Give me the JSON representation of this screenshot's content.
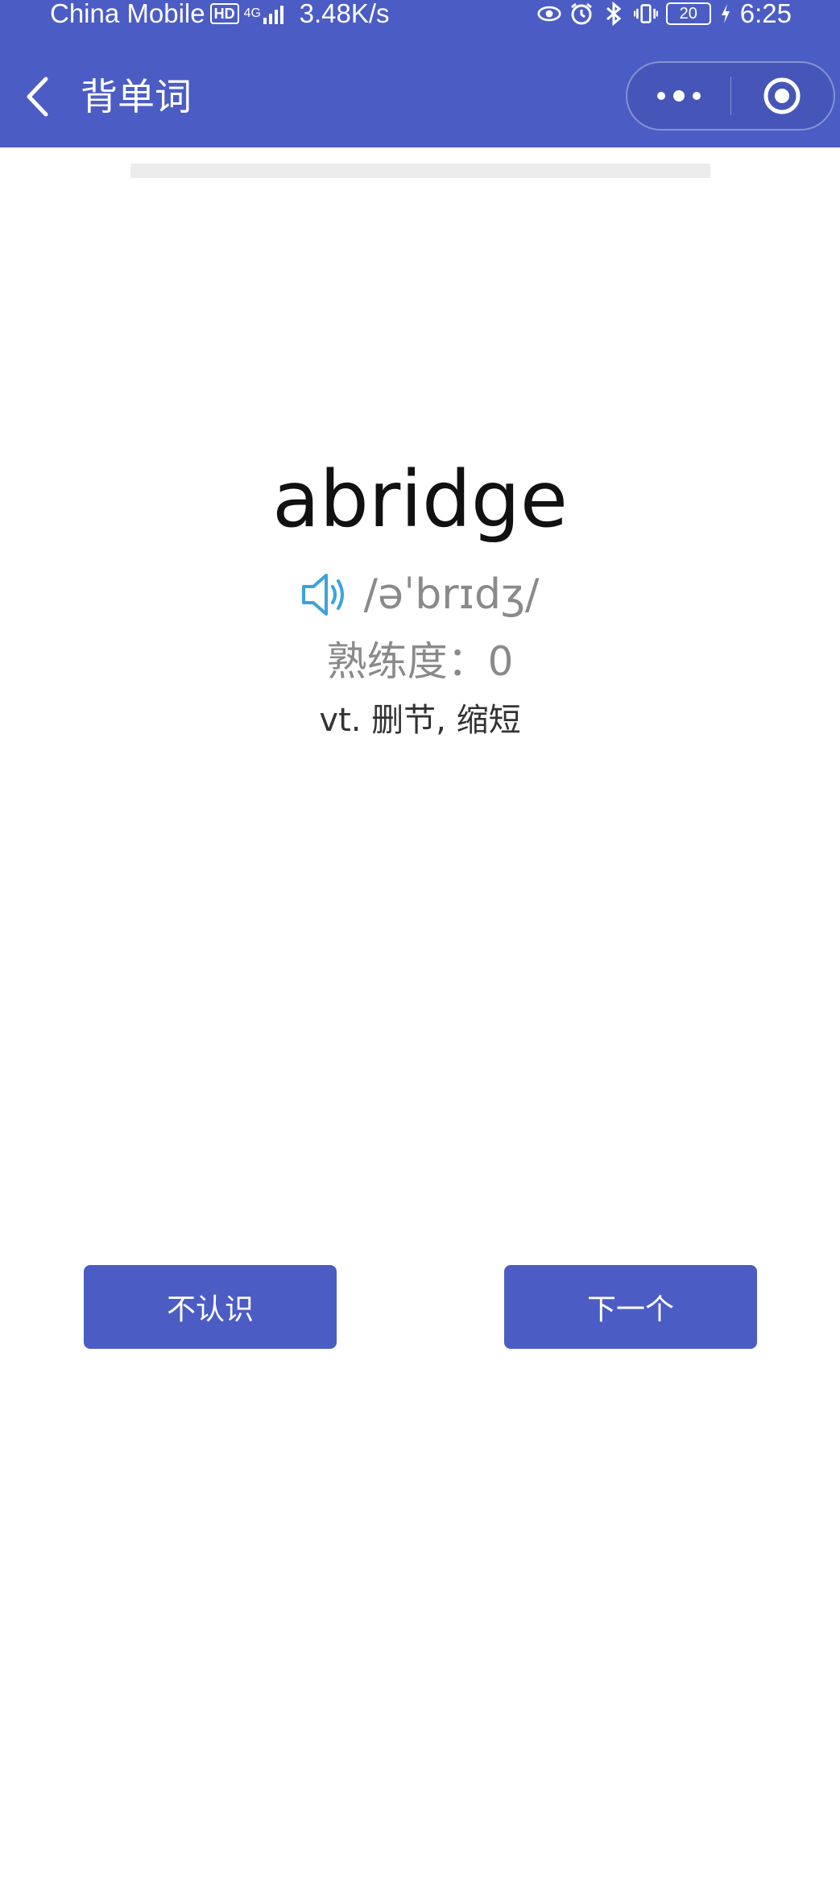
{
  "status_bar": {
    "carrier": "China Mobile",
    "hd": "HD",
    "network": "4G",
    "speed": "3.48K/s",
    "battery": "20",
    "time": "6:25",
    "icons": [
      "hd-icon",
      "signal-icon",
      "eye-icon",
      "alarm-icon",
      "bluetooth-icon",
      "vibrate-icon",
      "battery-icon",
      "charging-icon"
    ]
  },
  "nav": {
    "title": "背单词",
    "back_icon": "chevron-left-icon",
    "more_icon": "more-dots-icon",
    "close_icon": "target-circle-icon"
  },
  "progress": {
    "value": 0
  },
  "card": {
    "word": "abridge",
    "phonetic": "/əˈbrɪdʒ/",
    "speaker_icon": "speaker-icon",
    "proficiency_label": "熟练度：",
    "proficiency_value": "0",
    "meaning": "vt. 删节, 缩短"
  },
  "actions": {
    "unknown_label": "不认识",
    "next_label": "下一个"
  },
  "colors": {
    "primary": "#4b5cc4",
    "speaker": "#3aa3dc",
    "muted_text": "#8a8a8a"
  }
}
